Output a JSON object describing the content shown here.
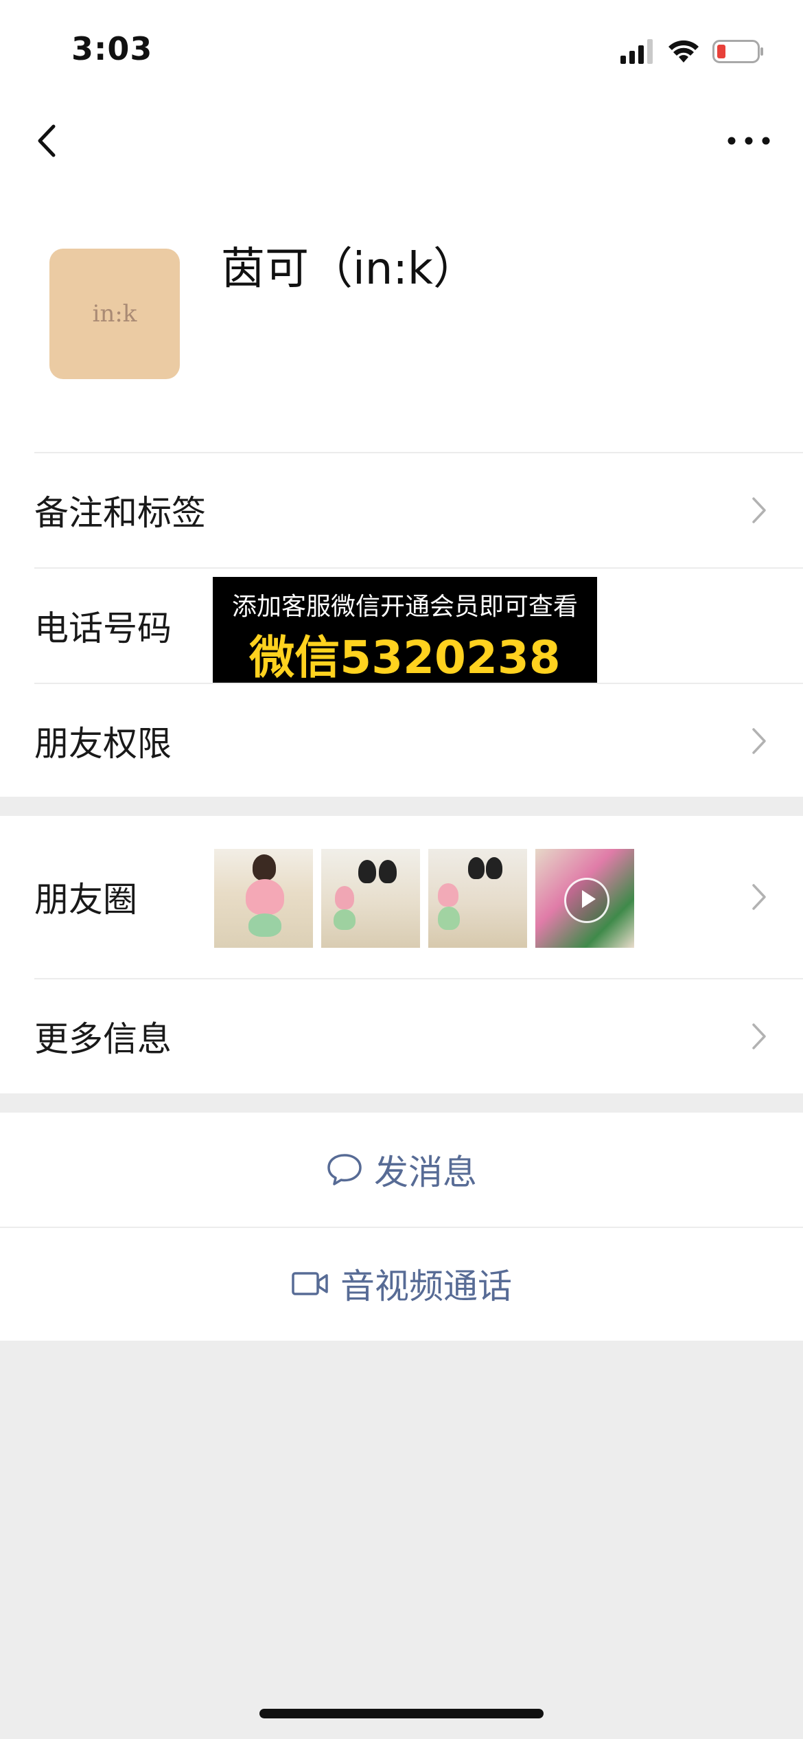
{
  "status_bar": {
    "time": "3:03"
  },
  "profile": {
    "avatar_text": "in:k",
    "name": "茵可（in:k）"
  },
  "rows": {
    "remarks_tags": "备注和标签",
    "phone": "电话号码",
    "friend_permissions": "朋友权限",
    "moments": "朋友圈",
    "more_info": "更多信息"
  },
  "overlay": {
    "line1": "添加客服微信开通会员即可查看",
    "line2": "微信5320238"
  },
  "actions": {
    "send_message": "发消息",
    "video_call": "音视频通话"
  },
  "colors": {
    "link": "#576b95",
    "background": "#ededed",
    "overlay_highlight": "#ffd21f"
  },
  "icons": [
    "back-icon",
    "more-icon",
    "signal-icon",
    "wifi-icon",
    "battery-icon",
    "chevron-right-icon",
    "chat-bubble-icon",
    "video-camera-icon",
    "play-icon"
  ]
}
